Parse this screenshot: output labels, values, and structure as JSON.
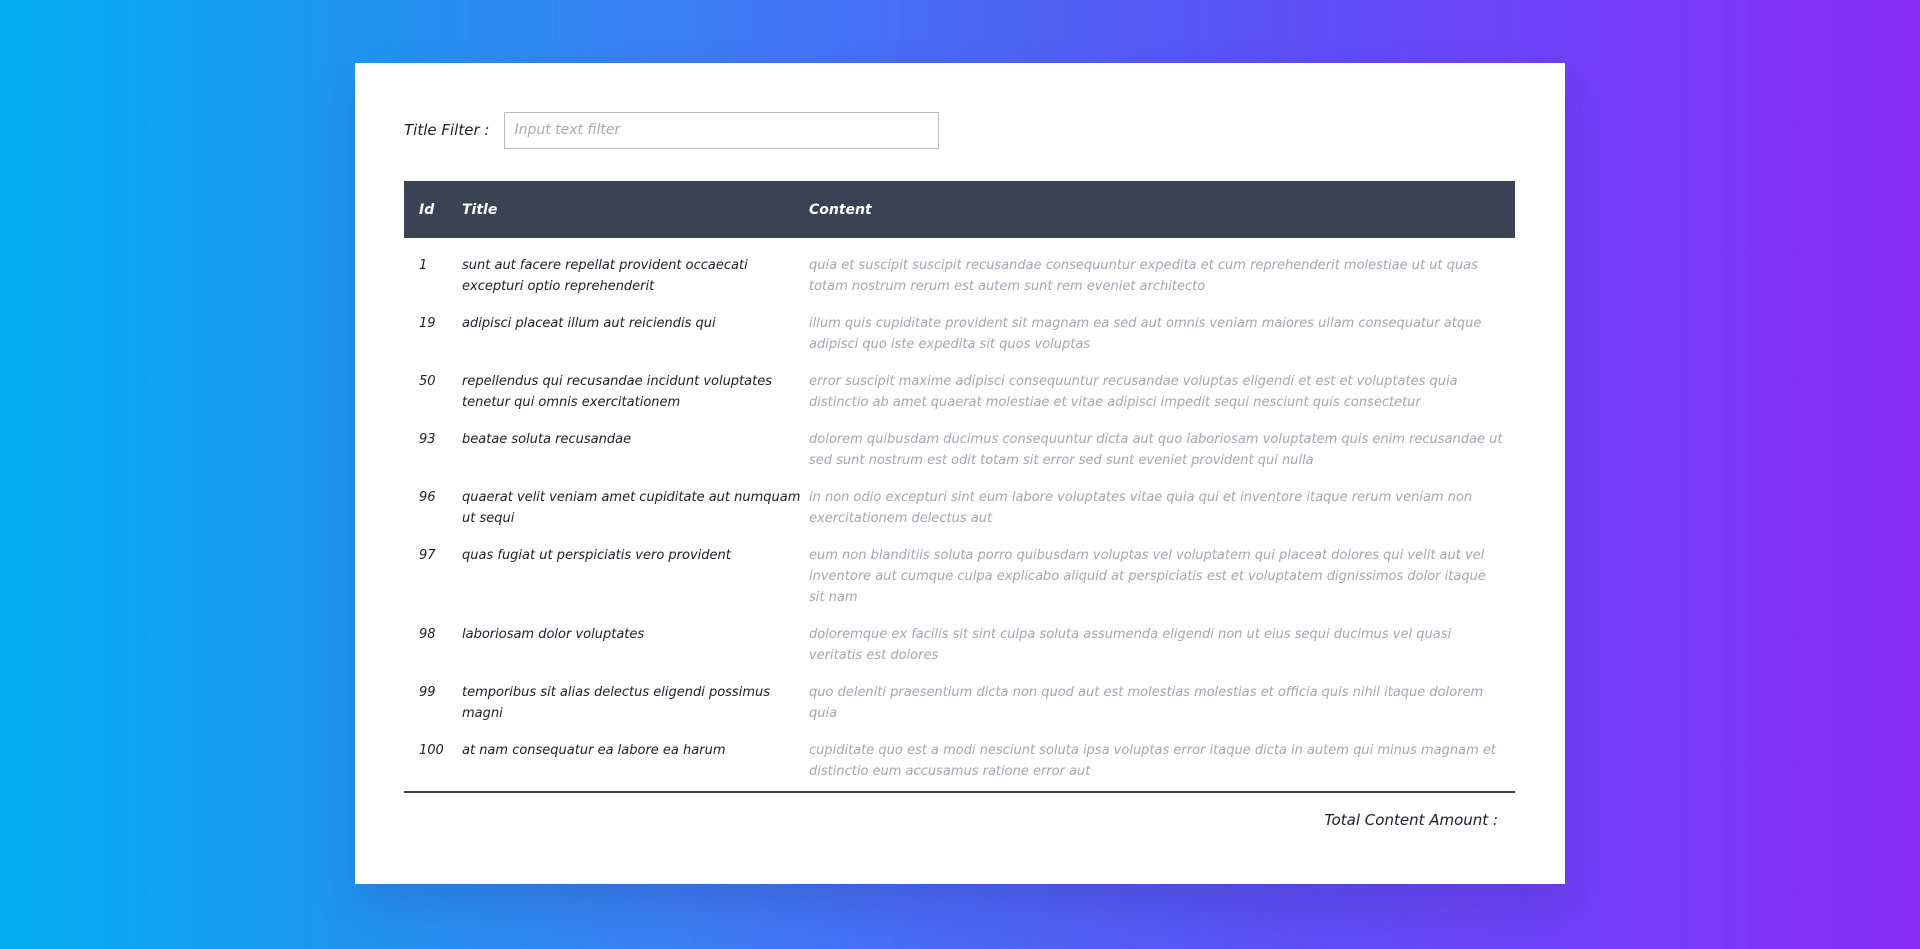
{
  "filter": {
    "label": "Title Filter :",
    "placeholder": "Input text filter",
    "value": ""
  },
  "table": {
    "headers": {
      "id": "Id",
      "title": "Title",
      "content": "Content"
    },
    "rows": [
      {
        "id": "1",
        "title": "sunt aut facere repellat provident occaecati excepturi optio reprehenderit",
        "content": "quia et suscipit suscipit recusandae consequuntur expedita et cum reprehenderit molestiae ut ut quas totam nostrum rerum est autem sunt rem eveniet architecto"
      },
      {
        "id": "19",
        "title": "adipisci placeat illum aut reiciendis qui",
        "content": "illum quis cupiditate provident sit magnam ea sed aut omnis veniam maiores ullam consequatur atque adipisci quo iste expedita sit quos voluptas"
      },
      {
        "id": "50",
        "title": "repellendus qui recusandae incidunt voluptates tenetur qui omnis exercitationem",
        "content": "error suscipit maxime adipisci consequuntur recusandae voluptas eligendi et est et voluptates quia distinctio ab amet quaerat molestiae et vitae adipisci impedit sequi nesciunt quis consectetur"
      },
      {
        "id": "93",
        "title": "beatae soluta recusandae",
        "content": "dolorem quibusdam ducimus consequuntur dicta aut quo laboriosam voluptatem quis enim recusandae ut sed sunt nostrum est odit totam sit error sed sunt eveniet provident qui nulla"
      },
      {
        "id": "96",
        "title": "quaerat velit veniam amet cupiditate aut numquam ut sequi",
        "content": "in non odio excepturi sint eum labore voluptates vitae quia qui et inventore itaque rerum veniam non exercitationem delectus aut"
      },
      {
        "id": "97",
        "title": "quas fugiat ut perspiciatis vero provident",
        "content": "eum non blanditiis soluta porro quibusdam voluptas vel voluptatem qui placeat dolores qui velit aut vel inventore aut cumque culpa explicabo aliquid at perspiciatis est et voluptatem dignissimos dolor itaque sit nam"
      },
      {
        "id": "98",
        "title": "laboriosam dolor voluptates",
        "content": "doloremque ex facilis sit sint culpa soluta assumenda eligendi non ut eius sequi ducimus vel quasi veritatis est dolores"
      },
      {
        "id": "99",
        "title": "temporibus sit alias delectus eligendi possimus magni",
        "content": "quo deleniti praesentium dicta non quod aut est molestias molestias et officia quis nihil itaque dolorem quia"
      },
      {
        "id": "100",
        "title": "at nam consequatur ea labore ea harum",
        "content": "cupiditate quo est a modi nesciunt soluta ipsa voluptas error itaque dicta in autem qui minus magnam et distinctio eum accusamus ratione error aut"
      }
    ]
  },
  "footer": {
    "total_label": "Total Content Amount :"
  },
  "colors": {
    "header_bg": "#3a4353",
    "content_text": "#a3a7b3",
    "gradient_start": "#03aef0",
    "gradient_end": "#8a2ef9"
  }
}
